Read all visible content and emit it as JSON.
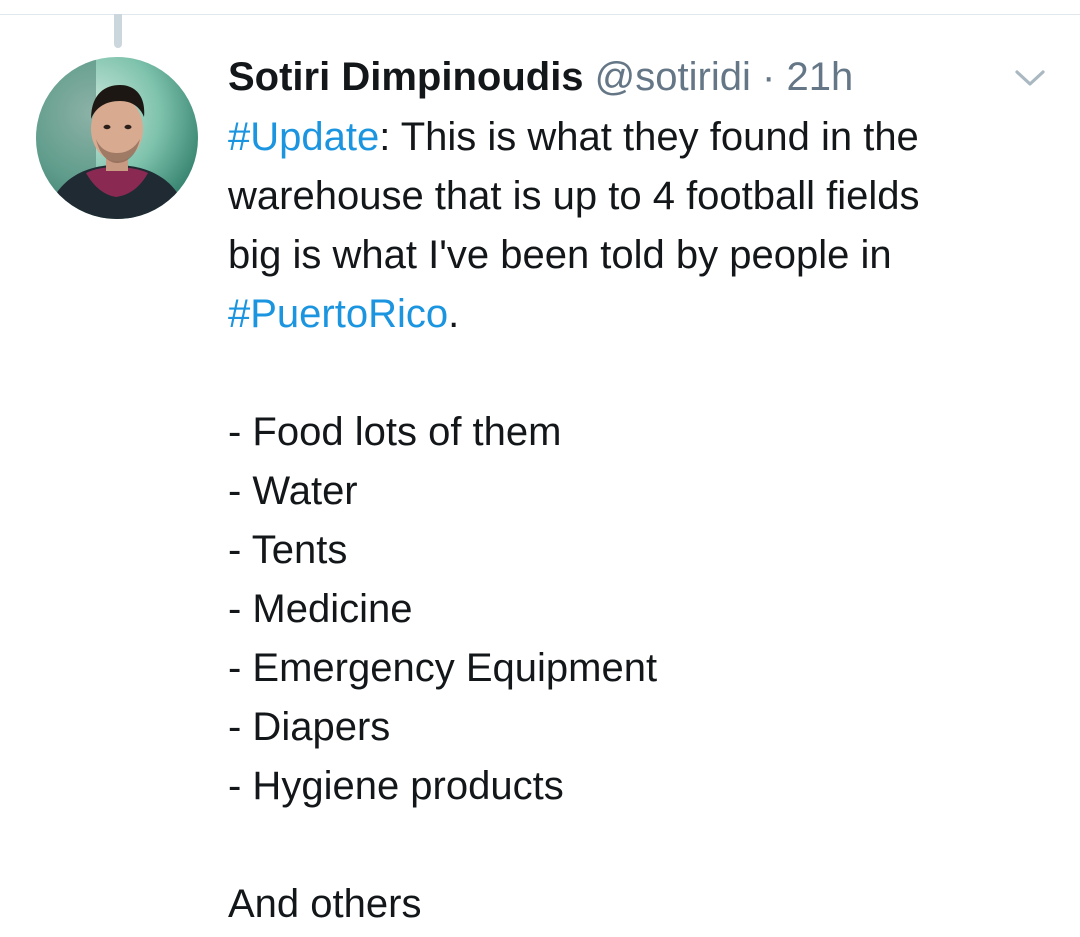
{
  "tweet": {
    "author": {
      "display_name": "Sotiri Dimpinoudis",
      "handle": "@sotiridi",
      "separator": "·",
      "time": "21h",
      "avatar_icon": "profile-photo"
    },
    "menu_icon": "chevron-down-icon",
    "body": {
      "intro_hashtag": "#Update",
      "intro_line1_rest": ": This is what they found in the",
      "intro_line2": "warehouse that is up to 4 football fields",
      "intro_line3": "big is what I've been told by people in",
      "location_hashtag": "#PuertoRico",
      "location_suffix": ".",
      "items": [
        "- Food lots of them",
        "- Water",
        "- Tents",
        "- Medicine",
        "- Emergency Equipment",
        "- Diapers",
        "- Hygiene products"
      ],
      "closing": "And others"
    }
  },
  "colors": {
    "link": "#1b95e0",
    "text": "#14171a",
    "secondary": "#657786",
    "thread_line": "#ccd6dd",
    "divider": "#e1e8ed"
  }
}
